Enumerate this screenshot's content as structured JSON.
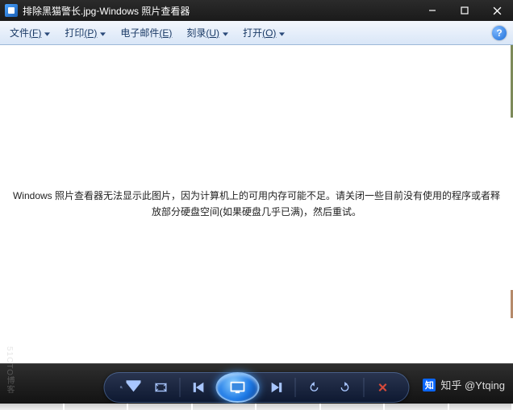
{
  "titlebar": {
    "filename": "排除黑猫警长.jpg",
    "separator": " - ",
    "app_name": "Windows 照片查看器"
  },
  "menu": {
    "file": {
      "label": "文件",
      "accel": "(F)"
    },
    "print": {
      "label": "打印",
      "accel": "(P)"
    },
    "email": {
      "label": "电子邮件",
      "accel": "(E)"
    },
    "burn": {
      "label": "刻录",
      "accel": "(U)"
    },
    "open": {
      "label": "打开",
      "accel": "(O)"
    },
    "help": "?"
  },
  "content": {
    "error_line1": "Windows 照片查看器无法显示此图片，因为计算机上的可用内存可能不足。请关闭一些目前没有使用的程序或者释",
    "error_line2": "放部分硬盘空间(如果硬盘几乎已满)，然后重试。"
  },
  "toolbar": {
    "zoom": "zoom",
    "fit": "fit",
    "prev": "previous",
    "play": "slideshow",
    "next": "next",
    "rotate_ccw": "rotate-left",
    "rotate_cw": "rotate-right",
    "delete": "delete"
  },
  "watermark": {
    "brand": "知",
    "text": "知乎 @Ytqing"
  },
  "faint_text": "51CTO博客"
}
